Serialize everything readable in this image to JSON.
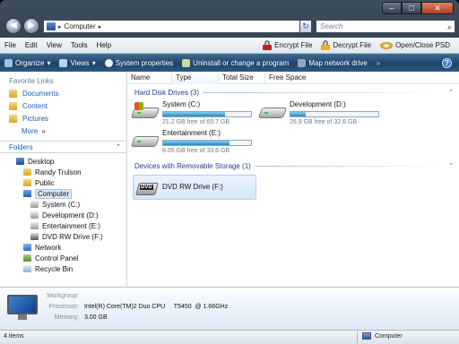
{
  "window": {
    "controls": [
      "–",
      "□",
      "✕"
    ]
  },
  "address": {
    "breadcrumb": "Computer",
    "search_placeholder": "Search"
  },
  "menubar": {
    "items": [
      "File",
      "Edit",
      "View",
      "Tools",
      "Help"
    ],
    "actions": [
      "Encrypt File",
      "Decrypt File",
      "Open/Close PSD"
    ]
  },
  "toolbar": {
    "items": [
      "Organize",
      "Views",
      "System properties",
      "Uninstall or change a program",
      "Map network drive"
    ],
    "overflow": "»",
    "help": "?"
  },
  "sidebar": {
    "favorites_title": "Favorite Links",
    "favorites": [
      "Documents",
      "Content",
      "Pictures"
    ],
    "more": "More",
    "more_arrows": "»",
    "folders_title": "Folders",
    "tree": [
      "Desktop",
      "Randy Trulson",
      "Public",
      "Computer",
      "System (C:)",
      "Development (D:)",
      "Entertainment (E:)",
      "DVD RW Drive (F:)",
      "Network",
      "Control Panel",
      "Recycle Bin"
    ]
  },
  "main": {
    "columns": [
      "Name",
      "Type",
      "Total Size",
      "Free Space"
    ],
    "group_hdd": "Hard Disk Drives (3)",
    "group_removable": "Devices with Removable Storage (1)",
    "drives": [
      {
        "name": "System (C:)",
        "free": "21.2 GB free of 69.7 GB",
        "used_fraction": 0.7
      },
      {
        "name": "Development (D:)",
        "free": "26.9 GB free of 32.6 GB",
        "used_fraction": 0.17
      },
      {
        "name": "Entertainment (E:)",
        "free": "8.05 GB free of 33.6 GB",
        "used_fraction": 0.76
      }
    ],
    "dvd": {
      "name": "DVD RW Drive (F:)",
      "label": "DVD"
    }
  },
  "details": {
    "workgroup_label": "Workgroup:",
    "workgroup_value": "",
    "processor_label": "Processor:",
    "processor_value": "Intel(R) Core(TM)2 Duo CPU     T5450  @ 1.66GHz",
    "memory_label": "Memory:",
    "memory_value": "3.00 GB"
  },
  "status": {
    "items_count": "4 items",
    "location": "Computer"
  },
  "colors": {
    "toolbar": "#1d4468",
    "link": "#1c5fb0",
    "bar_fill": "#1e8bc3",
    "group_title": "#1f3f8f"
  }
}
